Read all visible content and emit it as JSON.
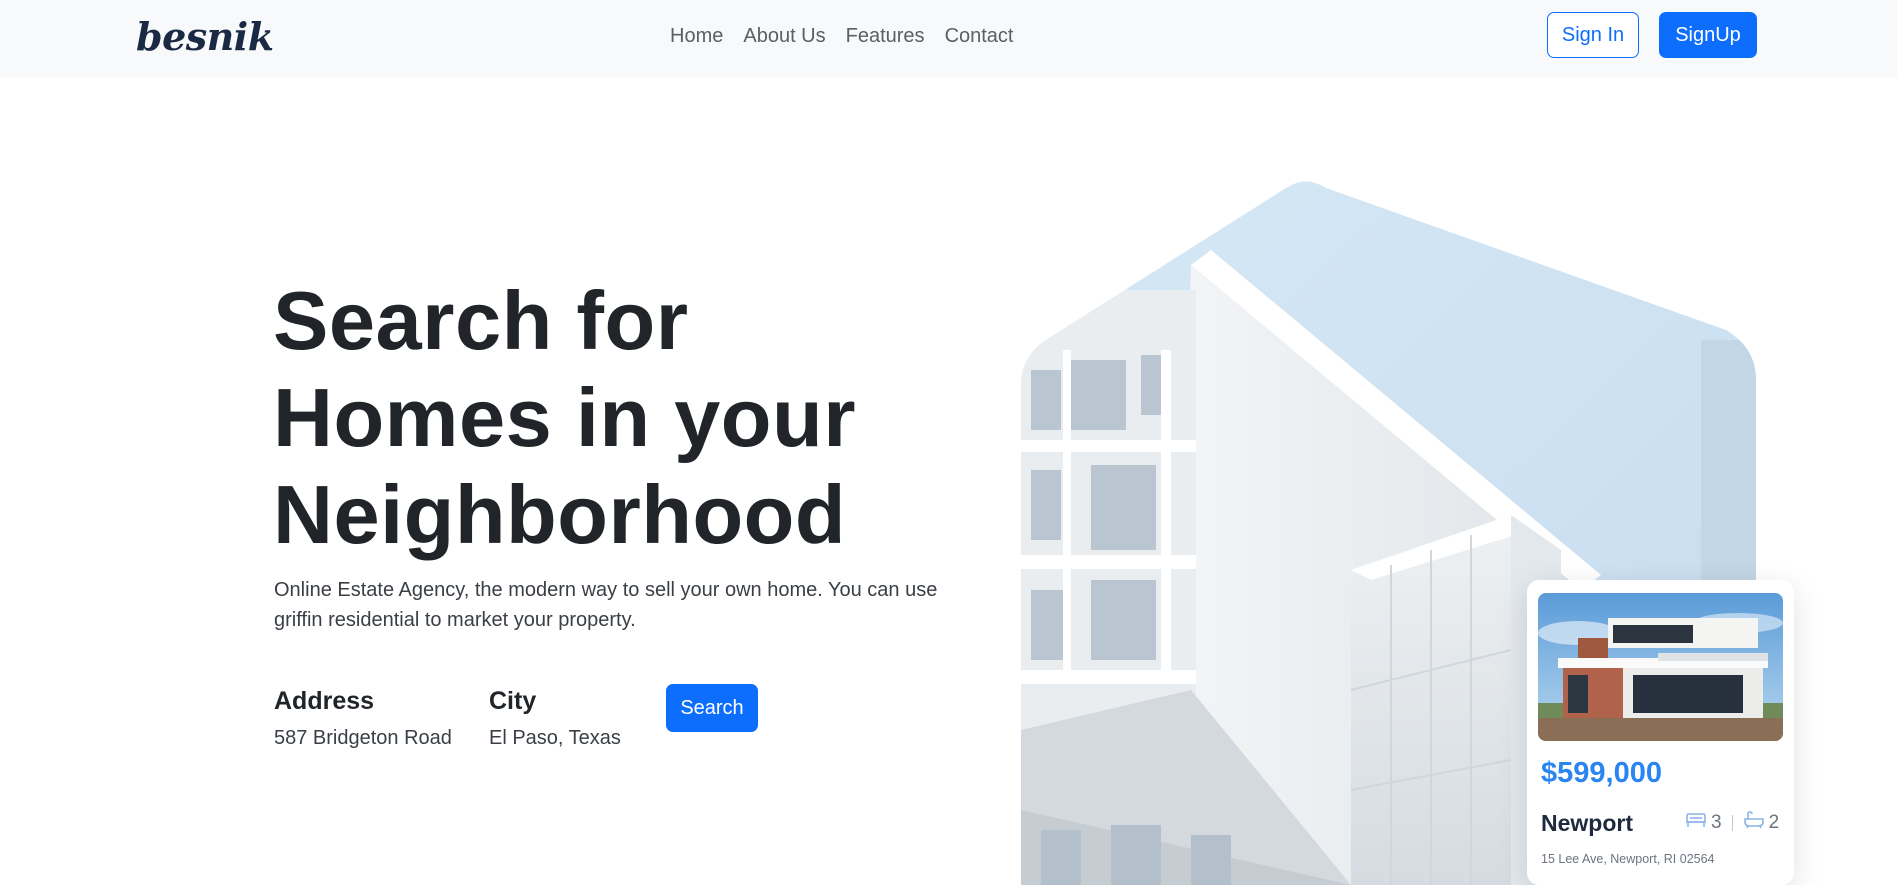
{
  "brand": {
    "name": "besnik"
  },
  "nav": {
    "links": [
      "Home",
      "About Us",
      "Features",
      "Contact"
    ],
    "signin_label": "Sign In",
    "signup_label": "SignUp"
  },
  "hero": {
    "title_lines": [
      "Search for",
      "Homes in your",
      "Neighborhood"
    ],
    "description": "Online Estate Agency, the modern way to sell your own home. You can use griffin residential to market your property.",
    "fields": [
      {
        "label": "Address",
        "value": "587 Bridgeton Road"
      },
      {
        "label": "City",
        "value": "El Paso, Texas"
      }
    ],
    "search_label": "Search"
  },
  "card": {
    "price": "$599,000",
    "name": "Newport",
    "beds": "3",
    "baths": "2",
    "address": "15 Lee Ave, Newport, RI 02564",
    "bed_icon": "bed-icon",
    "bath_icon": "bathtub-icon"
  },
  "colors": {
    "primary": "#0d6efd",
    "price": "#2b85f0",
    "nav_bg": "#f8f9fa",
    "sky": "#cfe3f3"
  }
}
